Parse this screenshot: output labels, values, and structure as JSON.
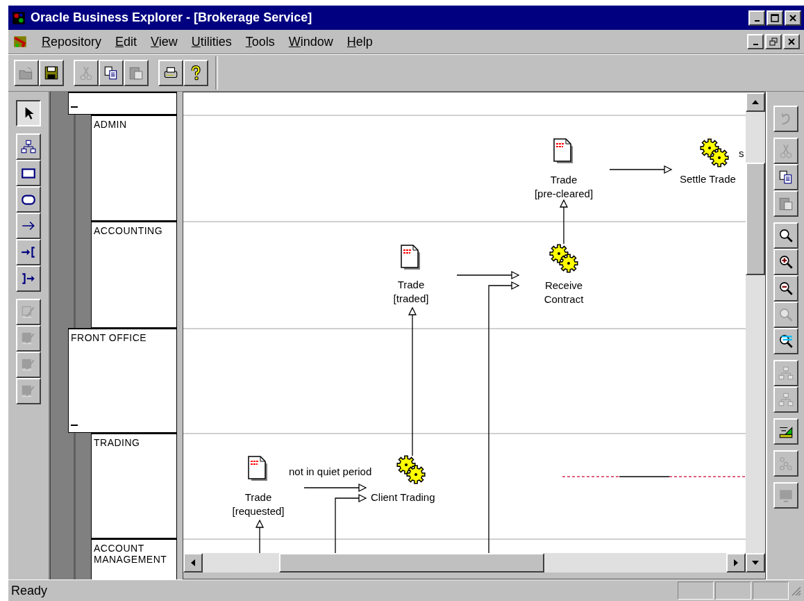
{
  "window": {
    "title": "Oracle Business Explorer - [Brokerage Service]"
  },
  "menu": [
    {
      "label": "Repository"
    },
    {
      "label": "Edit"
    },
    {
      "label": "View"
    },
    {
      "label": "Utilities"
    },
    {
      "label": "Tools"
    },
    {
      "label": "Window"
    },
    {
      "label": "Help"
    }
  ],
  "toolbar": {
    "groups": [
      [
        {
          "kind": "open",
          "disabled": true
        },
        {
          "kind": "save",
          "disabled": false
        }
      ],
      [
        {
          "kind": "cut",
          "disabled": true
        },
        {
          "kind": "copy",
          "disabled": false
        },
        {
          "kind": "paste",
          "disabled": true
        }
      ],
      [
        {
          "kind": "print",
          "disabled": false
        },
        {
          "kind": "help",
          "disabled": false
        }
      ]
    ]
  },
  "toolbox": {
    "groups": [
      [
        {
          "kind": "pointer",
          "selected": true,
          "disabled": false
        }
      ],
      [
        {
          "kind": "hierarchy",
          "selected": false,
          "disabled": false
        },
        {
          "kind": "rectangle",
          "selected": false,
          "disabled": false
        },
        {
          "kind": "rounded",
          "selected": false,
          "disabled": false
        },
        {
          "kind": "arrow",
          "selected": false,
          "disabled": false
        },
        {
          "kind": "arrow-in",
          "selected": false,
          "disabled": false
        },
        {
          "kind": "arrow-out",
          "selected": false,
          "disabled": false
        }
      ],
      [
        {
          "kind": "pen",
          "selected": false,
          "disabled": true
        },
        {
          "kind": "pen-fill",
          "selected": false,
          "disabled": true
        },
        {
          "kind": "paint",
          "selected": false,
          "disabled": true
        },
        {
          "kind": "font",
          "selected": false,
          "disabled": true
        }
      ]
    ]
  },
  "lanes": [
    {
      "expanded": true,
      "children": [
        {
          "label": "ADMIN"
        },
        {
          "label": "ACCOUNTING"
        }
      ]
    },
    {
      "label": "FRONT OFFICE",
      "expanded": true,
      "children": [
        {
          "label": "TRADING"
        },
        {
          "label": "ACCOUNT MANAGEMENT"
        }
      ]
    }
  ],
  "canvas": {
    "nodes": [
      {
        "kind": "document",
        "label": "Trade\n[pre-cleared]"
      },
      {
        "kind": "process",
        "label": "Settle Trade"
      },
      {
        "kind": "document",
        "label": "Trade\n[traded]"
      },
      {
        "kind": "process",
        "label": "Receive\nContract"
      },
      {
        "kind": "document",
        "label": "Trade\n[requested]"
      },
      {
        "kind": "process",
        "label": "Client Trading"
      }
    ],
    "labels": [
      "not in quiet period",
      "s"
    ]
  },
  "right_toolbar": {
    "groups": [
      [
        {
          "kind": "undo",
          "disabled": true
        }
      ],
      [
        {
          "kind": "cut",
          "disabled": true
        },
        {
          "kind": "copy",
          "disabled": false
        },
        {
          "kind": "paste",
          "disabled": true
        }
      ],
      [
        {
          "kind": "zoom",
          "disabled": false
        },
        {
          "kind": "zoom-in",
          "disabled": false
        },
        {
          "kind": "zoom-out",
          "disabled": false
        },
        {
          "kind": "zoom-fit",
          "disabled": true
        },
        {
          "kind": "find",
          "disabled": false
        }
      ],
      [
        {
          "kind": "tree-down",
          "disabled": true
        },
        {
          "kind": "tree-up",
          "disabled": true
        }
      ],
      [
        {
          "kind": "layout",
          "disabled": false
        }
      ],
      [
        {
          "kind": "scatter",
          "disabled": true
        }
      ],
      [
        {
          "kind": "display",
          "disabled": true
        }
      ]
    ]
  },
  "status_bar": {
    "text": "Ready"
  }
}
